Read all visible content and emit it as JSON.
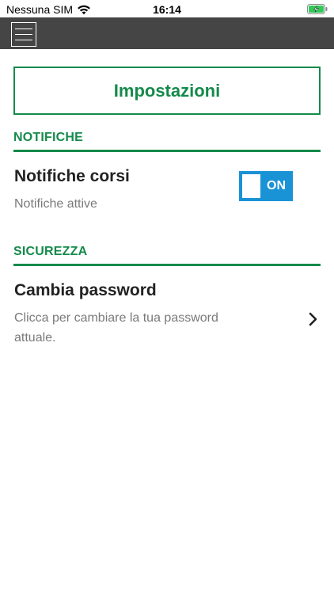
{
  "status_bar": {
    "carrier": "Nessuna SIM",
    "time": "16:14",
    "battery_color": "#34c759"
  },
  "nav": {
    "menu_icon": "hamburger-menu-icon",
    "bar_color": "#454545"
  },
  "page": {
    "title": "Impostazioni",
    "accent_color": "#158a4b"
  },
  "sections": {
    "notifiche": {
      "header": "NOTIFICHE",
      "row": {
        "title": "Notifiche corsi",
        "subtitle": "Notifiche attive",
        "toggle_label": "ON",
        "toggle_state": "on",
        "toggle_color": "#1a93d6"
      }
    },
    "sicurezza": {
      "header": "SICUREZZA",
      "row": {
        "title": "Cambia password",
        "subtitle": "Clicca per cambiare la tua password attuale.",
        "chevron_icon": "chevron-right-icon"
      }
    }
  }
}
